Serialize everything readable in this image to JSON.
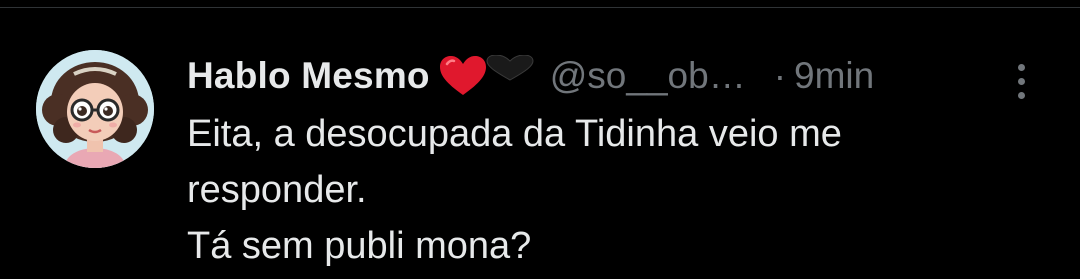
{
  "tweet": {
    "author": {
      "display_name": "Hablo Mesmo",
      "name_emojis": [
        "red-heart-icon",
        "black-heart-icon"
      ],
      "handle": "@so__ob…",
      "avatar": "cartoon-girl-avatar"
    },
    "separator": "·",
    "time": "9min",
    "more_icon": "more-vertical-icon",
    "text_lines": [
      "Eita, a desocupada da Tidinha veio me",
      "responder.",
      "Tá sem publi mona?"
    ]
  },
  "colors": {
    "background": "#000000",
    "primary_text": "#e7e9ea",
    "secondary_text": "#71767b",
    "divider": "#2f3336",
    "heart_red": "#e0182d"
  }
}
